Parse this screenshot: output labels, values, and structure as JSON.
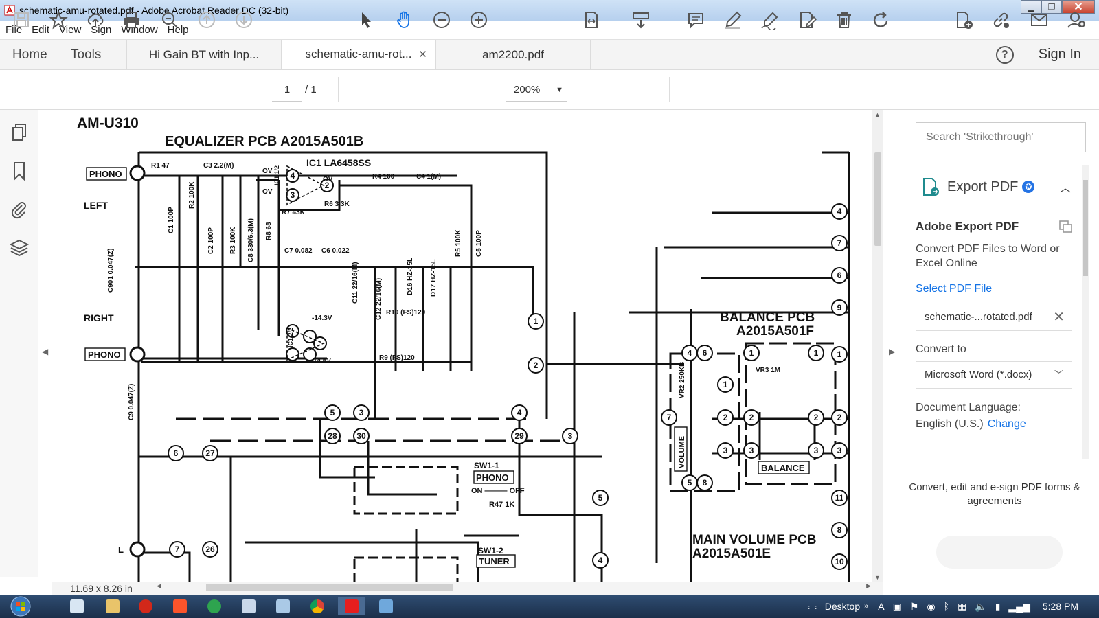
{
  "window": {
    "title": "schematic-amu-rotated.pdf - Adobe Acrobat Reader DC (32-bit)"
  },
  "menu": [
    "File",
    "Edit",
    "View",
    "Sign",
    "Window",
    "Help"
  ],
  "tabs": {
    "home": "Home",
    "tools": "Tools",
    "docs": [
      {
        "label": "Hi Gain BT with Inp..."
      },
      {
        "label": "schematic-amu-rot...",
        "active": true
      },
      {
        "label": "am2200.pdf"
      }
    ],
    "signin": "Sign In",
    "help": "?"
  },
  "toolbar": {
    "page_current": "1",
    "page_total": "/ 1",
    "zoom": "200%"
  },
  "schematic": {
    "model": "AM-U310",
    "eq_pcb": "EQUALIZER PCB  A2015A501B",
    "ic": "IC1 LA6458SS",
    "left": "LEFT",
    "right": "RIGHT",
    "phono1": "PHONO",
    "phono2": "PHONO",
    "balance_pcb": "BALANCE PCB",
    "balance_pn": "A2015A501F",
    "main_vol_pcb": "MAIN VOLUME PCB",
    "main_vol_pn": "A2015A501E",
    "volume": "VOLUME",
    "balance": "BALANCE",
    "sw1": "SW1-1",
    "sw1_label": "PHONO",
    "sw1_onoff": "ON ——— OFF",
    "sw2": "SW1-2",
    "sw2_label": "TUNER",
    "r47": "R47 1K",
    "vr2": "VR2 250KB",
    "vr3": "VR3 1M",
    "labels": {
      "r1": "R1 47",
      "c3": "C3 2.2(M)",
      "r4": "R4 100",
      "c4": "C4 1(M)",
      "r7": "R7 43K",
      "r6": "R6 3.3K",
      "c7": "C7 0.082",
      "c6": "C6 0.022",
      "c1": "C1 100P",
      "r2": "R2 100K",
      "c2": "C2 100P",
      "r3": "R3 100K",
      "c8": "C8 330/6.3(M)",
      "r8": "R8 68",
      "r5": "R5 100K",
      "c5": "C5 100P",
      "c901": "C901 0.047(Z)",
      "c9": "C9 0.047(Z)",
      "c11": "C11 22/16(M)",
      "c12": "C12 22/16(M)",
      "d16": "D16 HZ-15L",
      "d17": "D17 HZ-15L",
      "r10": "R10 (FS)120",
      "r9": "R9 (FS)120",
      "v1": "-14.3V",
      "v2": "14.6V",
      "ov1": "OV",
      "ov2": "OV",
      "ov3": "OV",
      "ic1a": "IC1 1/2",
      "ic1b": "IC1 2/2"
    },
    "nodes": [
      "4",
      "7",
      "6",
      "9",
      "1",
      "2",
      "5",
      "3",
      "28",
      "30",
      "29",
      "6",
      "27",
      "7",
      "26",
      "5",
      "4",
      "11",
      "8",
      "10",
      "1",
      "2",
      "3"
    ],
    "corner_L": "L"
  },
  "rightpane": {
    "search_placeholder": "Search 'Strikethrough'",
    "export_title": "Export PDF",
    "adobe_export": "Adobe Export PDF",
    "desc": "Convert PDF Files to Word or Excel Online",
    "select_file": "Select PDF File",
    "file_name": "schematic-...rotated.pdf",
    "convert_to": "Convert to",
    "convert_value": "Microsoft Word (*.docx)",
    "doc_lang_label": "Document Language:",
    "doc_lang_value": "English (U.S.)",
    "doc_lang_change": "Change",
    "promo": "Convert, edit and e-sign PDF forms & agreements"
  },
  "status": {
    "page_size": "11.69 x 8.26 in"
  },
  "taskbar": {
    "desktop": "Desktop",
    "time": "5:28 PM"
  },
  "colors": {
    "accent": "#1473e6",
    "hand_tool": "#1473e6"
  }
}
